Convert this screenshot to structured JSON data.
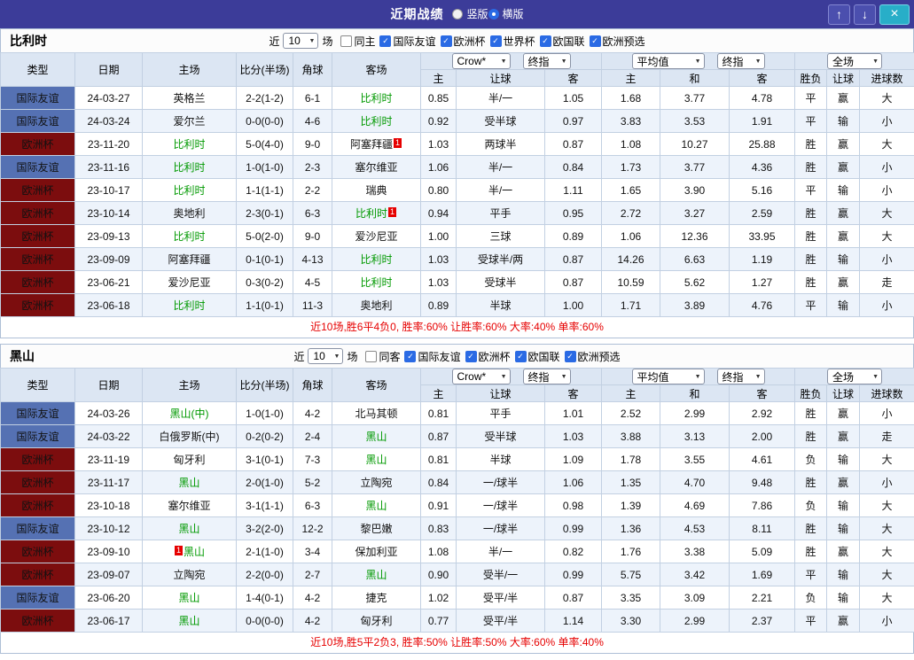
{
  "icons": {
    "check": "✓",
    "dropdown_arrow": "▼",
    "up_arrow": "↑",
    "down_arrow": "↓",
    "close": "×"
  },
  "colors": {
    "titlebar": "#3c3c99",
    "type_friendly_blue": "#5571b3",
    "type_euro_red": "#7c0d0e",
    "win_red": "#e60000",
    "draw_green": "#009933",
    "lose_blue": "#0000cc",
    "team_green": "#009900"
  },
  "titlebar": {
    "title": "近期战绩",
    "radios": [
      {
        "label": "竖版",
        "selected": false
      },
      {
        "label": "横版",
        "selected": true
      }
    ]
  },
  "table_header": {
    "type": "类型",
    "date": "日期",
    "home": "主场",
    "score": "比分(半场)",
    "corner": "角球",
    "away": "客场",
    "bookmaker_select": "Crow*",
    "final_select": "终指",
    "average_select": "平均值",
    "final_select2": "终指",
    "fullmatch_select": "全场",
    "odds_home": "主",
    "odds_handicap": "让球",
    "odds_away": "客",
    "avg_home": "主",
    "avg_draw": "和",
    "avg_away": "客",
    "result_wl": "胜负",
    "result_handicap": "让球",
    "result_goals": "进球数"
  },
  "sections": [
    {
      "team": "比利时",
      "filter": {
        "prefix": "近",
        "count": "10",
        "suffix": "场",
        "checkboxes": [
          {
            "label": "同主",
            "checked": false
          },
          {
            "label": "国际友谊",
            "checked": true
          },
          {
            "label": "欧洲杯",
            "checked": true
          },
          {
            "label": "世界杯",
            "checked": true
          },
          {
            "label": "欧国联",
            "checked": true
          },
          {
            "label": "欧洲预选",
            "checked": true
          }
        ]
      },
      "rows": [
        {
          "type": "国际友谊",
          "style": "blue",
          "date": "24-03-27",
          "home": {
            "name": "英格兰",
            "green": false
          },
          "score": "2-2(1-2)",
          "corner": "6-1",
          "away": {
            "name": "比利时",
            "green": true
          },
          "odds": [
            "0.85",
            "半/一",
            "1.05"
          ],
          "avg": [
            "1.68",
            "3.77",
            "4.78"
          ],
          "res": [
            [
              "平",
              "green"
            ],
            [
              "赢",
              "red"
            ],
            [
              "大",
              "red"
            ]
          ]
        },
        {
          "type": "国际友谊",
          "style": "blue",
          "date": "24-03-24",
          "home": {
            "name": "爱尔兰",
            "green": false
          },
          "score": "0-0(0-0)",
          "corner": "4-6",
          "away": {
            "name": "比利时",
            "green": true
          },
          "odds": [
            "0.92",
            "受半球",
            "0.97"
          ],
          "avg": [
            "3.83",
            "3.53",
            "1.91"
          ],
          "res": [
            [
              "平",
              "green"
            ],
            [
              "输",
              "blue"
            ],
            [
              "小",
              "blue"
            ]
          ]
        },
        {
          "type": "欧洲杯",
          "style": "red",
          "date": "23-11-20",
          "home": {
            "name": "比利时",
            "green": true
          },
          "score": "5-0(4-0)",
          "corner": "9-0",
          "away": {
            "name": "阿塞拜疆",
            "green": false,
            "card": "1",
            "card_side": "right"
          },
          "odds": [
            "1.03",
            "两球半",
            "0.87"
          ],
          "avg": [
            "1.08",
            "10.27",
            "25.88"
          ],
          "res": [
            [
              "胜",
              "red"
            ],
            [
              "赢",
              "red"
            ],
            [
              "大",
              "red"
            ]
          ]
        },
        {
          "type": "国际友谊",
          "style": "blue",
          "date": "23-11-16",
          "home": {
            "name": "比利时",
            "green": true
          },
          "score": "1-0(1-0)",
          "corner": "2-3",
          "away": {
            "name": "塞尔维亚",
            "green": false
          },
          "odds": [
            "1.06",
            "半/一",
            "0.84"
          ],
          "avg": [
            "1.73",
            "3.77",
            "4.36"
          ],
          "res": [
            [
              "胜",
              "red"
            ],
            [
              "赢",
              "red"
            ],
            [
              "小",
              "blue"
            ]
          ]
        },
        {
          "type": "欧洲杯",
          "style": "red",
          "date": "23-10-17",
          "home": {
            "name": "比利时",
            "green": true
          },
          "score": "1-1(1-1)",
          "corner": "2-2",
          "away": {
            "name": "瑞典",
            "green": false
          },
          "odds": [
            "0.80",
            "半/一",
            "1.11"
          ],
          "avg": [
            "1.65",
            "3.90",
            "5.16"
          ],
          "res": [
            [
              "平",
              "green"
            ],
            [
              "输",
              "blue"
            ],
            [
              "小",
              "blue"
            ]
          ]
        },
        {
          "type": "欧洲杯",
          "style": "red",
          "date": "23-10-14",
          "home": {
            "name": "奥地利",
            "green": false
          },
          "score": "2-3(0-1)",
          "corner": "6-3",
          "away": {
            "name": "比利时",
            "green": true,
            "card": "1",
            "card_side": "right"
          },
          "odds": [
            "0.94",
            "平手",
            "0.95"
          ],
          "avg": [
            "2.72",
            "3.27",
            "2.59"
          ],
          "res": [
            [
              "胜",
              "red"
            ],
            [
              "赢",
              "red"
            ],
            [
              "大",
              "red"
            ]
          ]
        },
        {
          "type": "欧洲杯",
          "style": "red",
          "date": "23-09-13",
          "home": {
            "name": "比利时",
            "green": true
          },
          "score": "5-0(2-0)",
          "corner": "9-0",
          "away": {
            "name": "爱沙尼亚",
            "green": false
          },
          "odds": [
            "1.00",
            "三球",
            "0.89"
          ],
          "avg": [
            "1.06",
            "12.36",
            "33.95"
          ],
          "res": [
            [
              "胜",
              "red"
            ],
            [
              "赢",
              "red"
            ],
            [
              "大",
              "red"
            ]
          ]
        },
        {
          "type": "欧洲杯",
          "style": "red",
          "date": "23-09-09",
          "home": {
            "name": "阿塞拜疆",
            "green": false
          },
          "score": "0-1(0-1)",
          "corner": "4-13",
          "away": {
            "name": "比利时",
            "green": true
          },
          "odds": [
            "1.03",
            "受球半/两",
            "0.87"
          ],
          "avg": [
            "14.26",
            "6.63",
            "1.19"
          ],
          "res": [
            [
              "胜",
              "red"
            ],
            [
              "输",
              "blue"
            ],
            [
              "小",
              "blue"
            ]
          ]
        },
        {
          "type": "欧洲杯",
          "style": "red",
          "date": "23-06-21",
          "home": {
            "name": "爱沙尼亚",
            "green": false
          },
          "score": "0-3(0-2)",
          "corner": "4-5",
          "away": {
            "name": "比利时",
            "green": true
          },
          "odds": [
            "1.03",
            "受球半",
            "0.87"
          ],
          "avg": [
            "10.59",
            "5.62",
            "1.27"
          ],
          "res": [
            [
              "胜",
              "red"
            ],
            [
              "赢",
              "red"
            ],
            [
              "走",
              "green"
            ]
          ]
        },
        {
          "type": "欧洲杯",
          "style": "red",
          "date": "23-06-18",
          "home": {
            "name": "比利时",
            "green": true
          },
          "score": "1-1(0-1)",
          "corner": "11-3",
          "away": {
            "name": "奥地利",
            "green": false
          },
          "odds": [
            "0.89",
            "半球",
            "1.00"
          ],
          "avg": [
            "1.71",
            "3.89",
            "4.76"
          ],
          "res": [
            [
              "平",
              "green"
            ],
            [
              "输",
              "blue"
            ],
            [
              "小",
              "blue"
            ]
          ]
        }
      ],
      "summary": "近10场,胜6平4负0, 胜率:60% 让胜率:60% 大率:40% 单率:60%"
    },
    {
      "team": "黑山",
      "filter": {
        "prefix": "近",
        "count": "10",
        "suffix": "场",
        "checkboxes": [
          {
            "label": "同客",
            "checked": false
          },
          {
            "label": "国际友谊",
            "checked": true
          },
          {
            "label": "欧洲杯",
            "checked": true
          },
          {
            "label": "欧国联",
            "checked": true
          },
          {
            "label": "欧洲预选",
            "checked": true
          }
        ]
      },
      "rows": [
        {
          "type": "国际友谊",
          "style": "blue",
          "date": "24-03-26",
          "home": {
            "name": "黑山(中)",
            "green": true
          },
          "score": "1-0(1-0)",
          "corner": "4-2",
          "away": {
            "name": "北马其顿",
            "green": false
          },
          "odds": [
            "0.81",
            "平手",
            "1.01"
          ],
          "avg": [
            "2.52",
            "2.99",
            "2.92"
          ],
          "res": [
            [
              "胜",
              "red"
            ],
            [
              "赢",
              "red"
            ],
            [
              "小",
              "blue"
            ]
          ]
        },
        {
          "type": "国际友谊",
          "style": "blue",
          "date": "24-03-22",
          "home": {
            "name": "白俄罗斯(中)",
            "green": false
          },
          "score": "0-2(0-2)",
          "corner": "2-4",
          "away": {
            "name": "黑山",
            "green": true
          },
          "odds": [
            "0.87",
            "受半球",
            "1.03"
          ],
          "avg": [
            "3.88",
            "3.13",
            "2.00"
          ],
          "res": [
            [
              "胜",
              "red"
            ],
            [
              "赢",
              "red"
            ],
            [
              "走",
              "green"
            ]
          ]
        },
        {
          "type": "欧洲杯",
          "style": "red",
          "date": "23-11-19",
          "home": {
            "name": "匈牙利",
            "green": false
          },
          "score": "3-1(0-1)",
          "corner": "7-3",
          "away": {
            "name": "黑山",
            "green": true
          },
          "odds": [
            "0.81",
            "半球",
            "1.09"
          ],
          "avg": [
            "1.78",
            "3.55",
            "4.61"
          ],
          "res": [
            [
              "负",
              "blue"
            ],
            [
              "输",
              "blue"
            ],
            [
              "大",
              "red"
            ]
          ]
        },
        {
          "type": "欧洲杯",
          "style": "red",
          "date": "23-11-17",
          "home": {
            "name": "黑山",
            "green": true
          },
          "score": "2-0(1-0)",
          "corner": "5-2",
          "away": {
            "name": "立陶宛",
            "green": false
          },
          "odds": [
            "0.84",
            "一/球半",
            "1.06"
          ],
          "avg": [
            "1.35",
            "4.70",
            "9.48"
          ],
          "res": [
            [
              "胜",
              "red"
            ],
            [
              "赢",
              "red"
            ],
            [
              "小",
              "blue"
            ]
          ]
        },
        {
          "type": "欧洲杯",
          "style": "red",
          "date": "23-10-18",
          "home": {
            "name": "塞尔维亚",
            "green": false
          },
          "score": "3-1(1-1)",
          "corner": "6-3",
          "away": {
            "name": "黑山",
            "green": true
          },
          "odds": [
            "0.91",
            "一/球半",
            "0.98"
          ],
          "avg": [
            "1.39",
            "4.69",
            "7.86"
          ],
          "res": [
            [
              "负",
              "blue"
            ],
            [
              "输",
              "blue"
            ],
            [
              "大",
              "red"
            ]
          ]
        },
        {
          "type": "国际友谊",
          "style": "blue",
          "date": "23-10-12",
          "home": {
            "name": "黑山",
            "green": true
          },
          "score": "3-2(2-0)",
          "corner": "12-2",
          "away": {
            "name": "黎巴嫩",
            "green": false
          },
          "odds": [
            "0.83",
            "一/球半",
            "0.99"
          ],
          "avg": [
            "1.36",
            "4.53",
            "8.11"
          ],
          "res": [
            [
              "胜",
              "red"
            ],
            [
              "输",
              "blue"
            ],
            [
              "大",
              "red"
            ]
          ]
        },
        {
          "type": "欧洲杯",
          "style": "red",
          "date": "23-09-10",
          "home": {
            "name": "黑山",
            "green": true,
            "card": "1",
            "card_side": "left"
          },
          "score": "2-1(1-0)",
          "corner": "3-4",
          "away": {
            "name": "保加利亚",
            "green": false
          },
          "odds": [
            "1.08",
            "半/一",
            "0.82"
          ],
          "avg": [
            "1.76",
            "3.38",
            "5.09"
          ],
          "res": [
            [
              "胜",
              "red"
            ],
            [
              "赢",
              "red"
            ],
            [
              "大",
              "red"
            ]
          ]
        },
        {
          "type": "欧洲杯",
          "style": "red",
          "date": "23-09-07",
          "home": {
            "name": "立陶宛",
            "green": false
          },
          "score": "2-2(0-0)",
          "corner": "2-7",
          "away": {
            "name": "黑山",
            "green": true
          },
          "odds": [
            "0.90",
            "受半/一",
            "0.99"
          ],
          "avg": [
            "5.75",
            "3.42",
            "1.69"
          ],
          "res": [
            [
              "平",
              "green"
            ],
            [
              "输",
              "blue"
            ],
            [
              "大",
              "red"
            ]
          ]
        },
        {
          "type": "国际友谊",
          "style": "blue",
          "date": "23-06-20",
          "home": {
            "name": "黑山",
            "green": true
          },
          "score": "1-4(0-1)",
          "corner": "4-2",
          "away": {
            "name": "捷克",
            "green": false
          },
          "odds": [
            "1.02",
            "受平/半",
            "0.87"
          ],
          "avg": [
            "3.35",
            "3.09",
            "2.21"
          ],
          "res": [
            [
              "负",
              "blue"
            ],
            [
              "输",
              "blue"
            ],
            [
              "大",
              "red"
            ]
          ]
        },
        {
          "type": "欧洲杯",
          "style": "red",
          "date": "23-06-17",
          "home": {
            "name": "黑山",
            "green": true
          },
          "score": "0-0(0-0)",
          "corner": "4-2",
          "away": {
            "name": "匈牙利",
            "green": false
          },
          "odds": [
            "0.77",
            "受平/半",
            "1.14"
          ],
          "avg": [
            "3.30",
            "2.99",
            "2.37"
          ],
          "res": [
            [
              "平",
              "green"
            ],
            [
              "赢",
              "red"
            ],
            [
              "小",
              "blue"
            ]
          ]
        }
      ],
      "summary": "近10场,胜5平2负3, 胜率:50% 让胜率:50% 大率:60% 单率:40%"
    }
  ]
}
